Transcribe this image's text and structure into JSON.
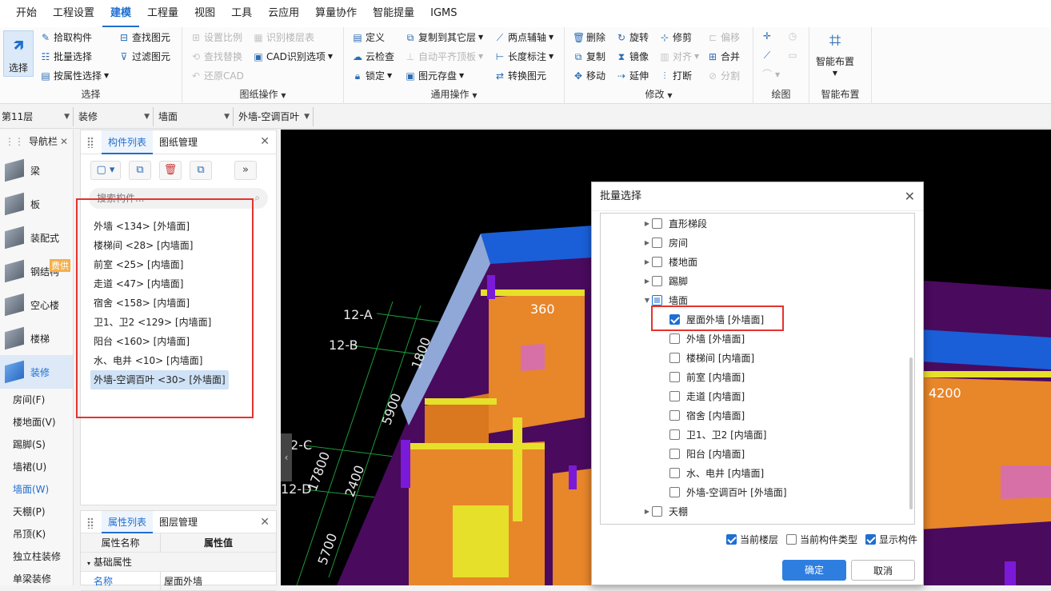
{
  "menu": [
    "开始",
    "工程设置",
    "建模",
    "工程量",
    "视图",
    "工具",
    "云应用",
    "算量协作",
    "智能提量",
    "IGMS"
  ],
  "ribbon": {
    "select_group": {
      "big_label": "选择",
      "items": [
        "拾取构件",
        "批量选择",
        "按属性选择",
        "查找图元",
        "过滤图元"
      ],
      "title": "选择"
    },
    "drawing_group": {
      "items": [
        "设置比例",
        "识别楼层表",
        "查找替换",
        "CAD识别选项",
        "还原CAD"
      ],
      "title": "图纸操作"
    },
    "common_group": {
      "items": [
        "定义",
        "复制到其它层",
        "两点辅轴",
        "云检查",
        "自动平齐顶板",
        "长度标注",
        "锁定",
        "图元存盘",
        "转换图元"
      ],
      "title": "通用操作"
    },
    "modify_group": {
      "items": [
        "删除",
        "旋转",
        "修剪",
        "偏移",
        "复制",
        "镜像",
        "对齐",
        "合并",
        "移动",
        "延伸",
        "打断",
        "分割"
      ],
      "title": "修改"
    },
    "draw_group": {
      "title": "绘图"
    },
    "smart_group": {
      "label": "智能布置",
      "title": "智能布置"
    }
  },
  "toolbar2": {
    "floor": "第11层",
    "category": "装修",
    "type": "墙面",
    "component": "外墙-空调百叶"
  },
  "nav": {
    "title": "导航栏",
    "items": [
      "梁",
      "板",
      "装配式",
      "钢结构",
      "空心楼",
      "楼梯",
      "装修"
    ],
    "badge": "费供",
    "subitems": [
      "房间(F)",
      "楼地面(V)",
      "踢脚(S)",
      "墙裙(U)",
      "墙面(W)",
      "天棚(P)",
      "吊顶(K)",
      "独立柱装修",
      "单梁装修"
    ]
  },
  "comp_panel": {
    "tabs": [
      "构件列表",
      "图纸管理"
    ],
    "search_placeholder": "搜索构件...",
    "items": [
      "外墙 <134> [外墙面]",
      "楼梯间 <28> [内墙面]",
      "前室 <25> [内墙面]",
      "走道 <47> [内墙面]",
      "宿舍 <158> [内墙面]",
      "卫1、卫2 <129> [内墙面]",
      "阳台 <160> [内墙面]",
      "水、电井 <10> [内墙面]",
      "外墙-空调百叶 <30> [外墙面]"
    ]
  },
  "prop_panel": {
    "tabs": [
      "属性列表",
      "图层管理"
    ],
    "headers": [
      "属性名称",
      "属性值"
    ],
    "section": "基础属性",
    "row": {
      "name": "名称",
      "value": "屋面外墙"
    }
  },
  "viewport": {
    "labels": [
      "12-A",
      "12-B",
      "1800",
      "5900",
      "2-C",
      "12-D",
      "17800",
      "2400",
      "5700",
      "360",
      "4200"
    ]
  },
  "dialog": {
    "title": "批量选择",
    "tree": [
      {
        "label": "直形梯段",
        "level": 0,
        "checked": false
      },
      {
        "label": "房间",
        "level": 0,
        "checked": false
      },
      {
        "label": "楼地面",
        "level": 0,
        "checked": false
      },
      {
        "label": "踢脚",
        "level": 0,
        "checked": false
      },
      {
        "label": "墙面",
        "level": 0,
        "checked": "partial",
        "expanded": true
      },
      {
        "label": "屋面外墙 [外墙面]",
        "level": 1,
        "checked": true
      },
      {
        "label": "外墙 [外墙面]",
        "level": 1,
        "checked": false
      },
      {
        "label": "楼梯间 [内墙面]",
        "level": 1,
        "checked": false
      },
      {
        "label": "前室 [内墙面]",
        "level": 1,
        "checked": false
      },
      {
        "label": "走道 [内墙面]",
        "level": 1,
        "checked": false
      },
      {
        "label": "宿舍 [内墙面]",
        "level": 1,
        "checked": false
      },
      {
        "label": "卫1、卫2 [内墙面]",
        "level": 1,
        "checked": false
      },
      {
        "label": "阳台 [内墙面]",
        "level": 1,
        "checked": false
      },
      {
        "label": "水、电井 [内墙面]",
        "level": 1,
        "checked": false
      },
      {
        "label": "外墙-空调百叶 [外墙面]",
        "level": 1,
        "checked": false
      },
      {
        "label": "天棚",
        "level": 0,
        "checked": false
      }
    ],
    "options": [
      {
        "label": "当前楼层",
        "checked": true
      },
      {
        "label": "当前构件类型",
        "checked": false
      },
      {
        "label": "显示构件",
        "checked": true
      }
    ],
    "ok": "确定",
    "cancel": "取消"
  },
  "colors": {
    "accent": "#1f6fd1",
    "highlight_box": "#e5322d",
    "wall_orange": "#e8862a",
    "slab_purple": "#5a0a6e",
    "wall_blue": "#1a5fd8",
    "yellow": "#e6e02a"
  }
}
